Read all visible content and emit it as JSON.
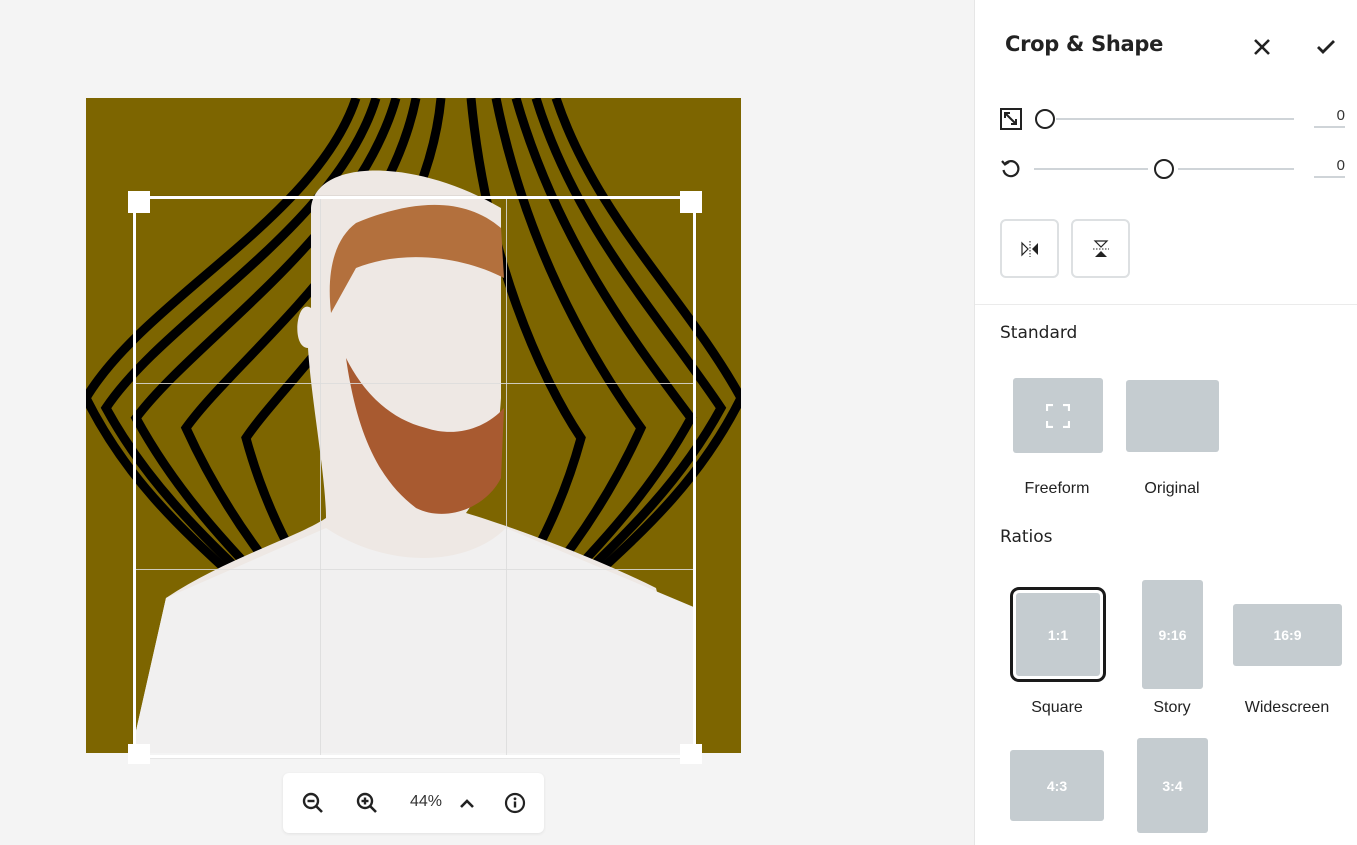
{
  "panel": {
    "title": "Crop & Shape",
    "close_icon": "close-icon",
    "confirm_icon": "checkmark-icon",
    "sliders": [
      {
        "name": "scale",
        "icon": "resize-icon",
        "value": "0",
        "position": 0.0
      },
      {
        "name": "rotate",
        "icon": "rotate-icon",
        "value": "0",
        "position": 0.5
      }
    ],
    "flip_buttons": [
      {
        "name": "flip-horizontal",
        "icon": "flip-horizontal-icon"
      },
      {
        "name": "flip-vertical",
        "icon": "flip-vertical-icon"
      }
    ],
    "standard": {
      "heading": "Standard",
      "items": [
        {
          "label": "Freeform",
          "icon": "freeform-icon"
        },
        {
          "label": "Original"
        }
      ]
    },
    "ratios": {
      "heading": "Ratios",
      "items": [
        {
          "ratio": "1:1",
          "label": "Square",
          "selected": true
        },
        {
          "ratio": "9:16",
          "label": "Story",
          "selected": false
        },
        {
          "ratio": "16:9",
          "label": "Widescreen",
          "selected": false
        },
        {
          "ratio": "4:3",
          "label": "",
          "selected": false
        },
        {
          "ratio": "3:4",
          "label": "",
          "selected": false
        }
      ]
    }
  },
  "canvas": {
    "image_description": "Bearded man in white t-shirt on olive background with black curved stripes",
    "background_color": "#7d6500",
    "stripe_color": "#000000"
  },
  "zoombar": {
    "zoom_out_icon": "zoom-out-icon",
    "zoom_in_icon": "zoom-in-icon",
    "zoom_value": "44%",
    "expand_icon": "chevron-up-icon",
    "info_icon": "info-icon"
  }
}
